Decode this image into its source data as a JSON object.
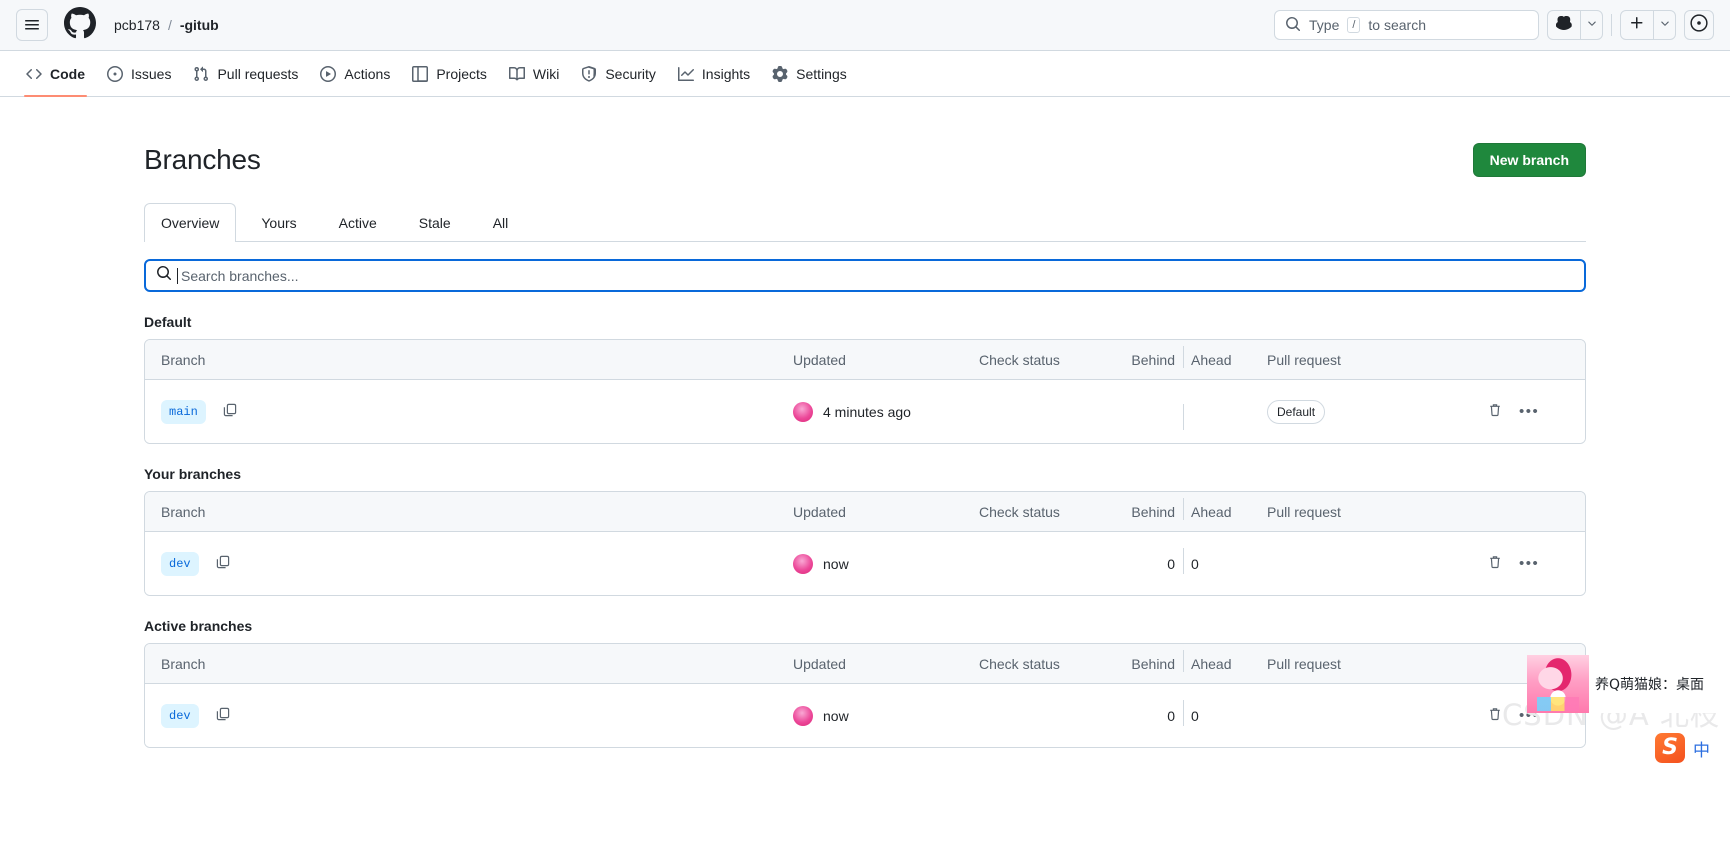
{
  "header": {
    "menu_icon": "hamburger-icon",
    "logo_icon": "github-logo-icon",
    "owner": "pcb178",
    "separator": "/",
    "repo": "-gitub",
    "search": {
      "icon": "search-icon",
      "prefix": "Type",
      "kbd": "/",
      "suffix": "to search"
    },
    "copilot_icon": "copilot-icon",
    "copilot_caret_icon": "chevron-down-icon",
    "plus_icon": "plus-icon",
    "plus_caret_icon": "chevron-down-icon",
    "avatar_icon": "user-avatar-icon"
  },
  "repo_nav": {
    "items": [
      {
        "label": "Code",
        "icon": "code-icon",
        "active": true
      },
      {
        "label": "Issues",
        "icon": "issue-opened-icon",
        "active": false
      },
      {
        "label": "Pull requests",
        "icon": "git-pull-request-icon",
        "active": false
      },
      {
        "label": "Actions",
        "icon": "play-icon",
        "active": false
      },
      {
        "label": "Projects",
        "icon": "table-icon",
        "active": false
      },
      {
        "label": "Wiki",
        "icon": "book-icon",
        "active": false
      },
      {
        "label": "Security",
        "icon": "shield-icon",
        "active": false
      },
      {
        "label": "Insights",
        "icon": "graph-icon",
        "active": false
      },
      {
        "label": "Settings",
        "icon": "gear-icon",
        "active": false
      }
    ]
  },
  "page": {
    "title": "Branches",
    "new_branch_label": "New branch",
    "tabs": [
      {
        "label": "Overview",
        "selected": true
      },
      {
        "label": "Yours",
        "selected": false
      },
      {
        "label": "Active",
        "selected": false
      },
      {
        "label": "Stale",
        "selected": false
      },
      {
        "label": "All",
        "selected": false
      }
    ],
    "branch_search": {
      "icon": "search-icon",
      "placeholder": "Search branches...",
      "value": ""
    },
    "columns": {
      "branch": "Branch",
      "updated": "Updated",
      "check_status": "Check status",
      "behind": "Behind",
      "ahead": "Ahead",
      "pull_request": "Pull request"
    },
    "sections": [
      {
        "title": "Default",
        "rows": [
          {
            "branch": "main",
            "copy_icon": "copy-icon",
            "avatar": "user-avatar-icon",
            "updated": "4 minutes ago",
            "check_status": "",
            "behind": "",
            "ahead": "",
            "pull_request": "",
            "badge": "Default",
            "delete_icon": "trash-icon",
            "menu_icon": "kebab-horizontal-icon"
          }
        ]
      },
      {
        "title": "Your branches",
        "rows": [
          {
            "branch": "dev",
            "copy_icon": "copy-icon",
            "avatar": "user-avatar-icon",
            "updated": "now",
            "check_status": "",
            "behind": "0",
            "ahead": "0",
            "pull_request": "",
            "badge": "",
            "delete_icon": "trash-icon",
            "menu_icon": "kebab-horizontal-icon"
          }
        ]
      },
      {
        "title": "Active branches",
        "rows": [
          {
            "branch": "dev",
            "copy_icon": "copy-icon",
            "avatar": "user-avatar-icon",
            "updated": "now",
            "check_status": "",
            "behind": "0",
            "ahead": "0",
            "pull_request": "",
            "badge": "",
            "delete_icon": "trash-icon",
            "menu_icon": "kebab-horizontal-icon"
          }
        ]
      }
    ]
  },
  "overlays": {
    "ad": {
      "text": "养Q萌猫娘：桌面",
      "thumb_icon": "anime-girl-thumbnail"
    },
    "ime": {
      "logo": "sogou-ime-icon",
      "mode": "中"
    },
    "watermark": "CSDN @A 北枝"
  },
  "colors": {
    "accent_green": "#1f883d",
    "accent_blue": "#0969da",
    "tab_underline": "#fd8c73",
    "branch_pill_bg": "#ddf4ff",
    "header_bg": "#f6f8fa",
    "border": "#d1d9e0"
  }
}
